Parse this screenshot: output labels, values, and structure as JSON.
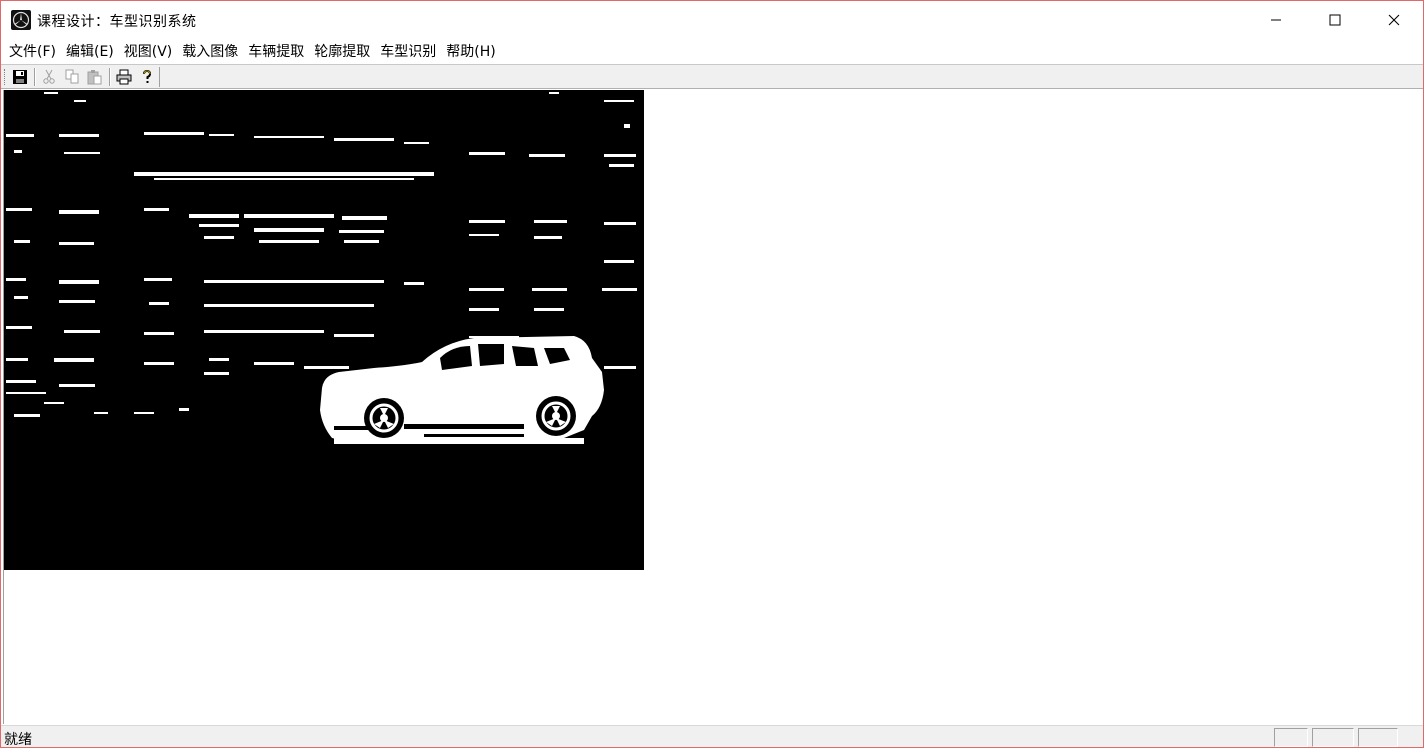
{
  "window": {
    "title": "课程设计：车型识别系统",
    "app_icon": "mercedes-logo-icon",
    "controls": [
      "minimize-icon",
      "maximize-icon",
      "close-icon"
    ]
  },
  "menu": {
    "items": [
      {
        "label": "文件(F)"
      },
      {
        "label": "编辑(E)"
      },
      {
        "label": "视图(V)"
      },
      {
        "label": "载入图像"
      },
      {
        "label": "车辆提取"
      },
      {
        "label": "轮廓提取"
      },
      {
        "label": "车型识别"
      },
      {
        "label": "帮助(H)"
      }
    ]
  },
  "toolbar": {
    "buttons": [
      {
        "icon": "save-icon",
        "enabled": true
      },
      {
        "icon": "cut-icon",
        "enabled": false
      },
      {
        "icon": "copy-icon",
        "enabled": false
      },
      {
        "icon": "paste-icon",
        "enabled": false
      },
      {
        "icon": "print-icon",
        "enabled": true
      },
      {
        "icon": "help-icon",
        "enabled": true
      }
    ]
  },
  "canvas": {
    "content": "binary-segmented-car-image",
    "background": "#000000",
    "foreground": "#ffffff"
  },
  "status": {
    "text": "就绪",
    "panes": 3
  },
  "colors": {
    "window_border": "#e06a6a",
    "chrome": "#f0f0f0"
  }
}
